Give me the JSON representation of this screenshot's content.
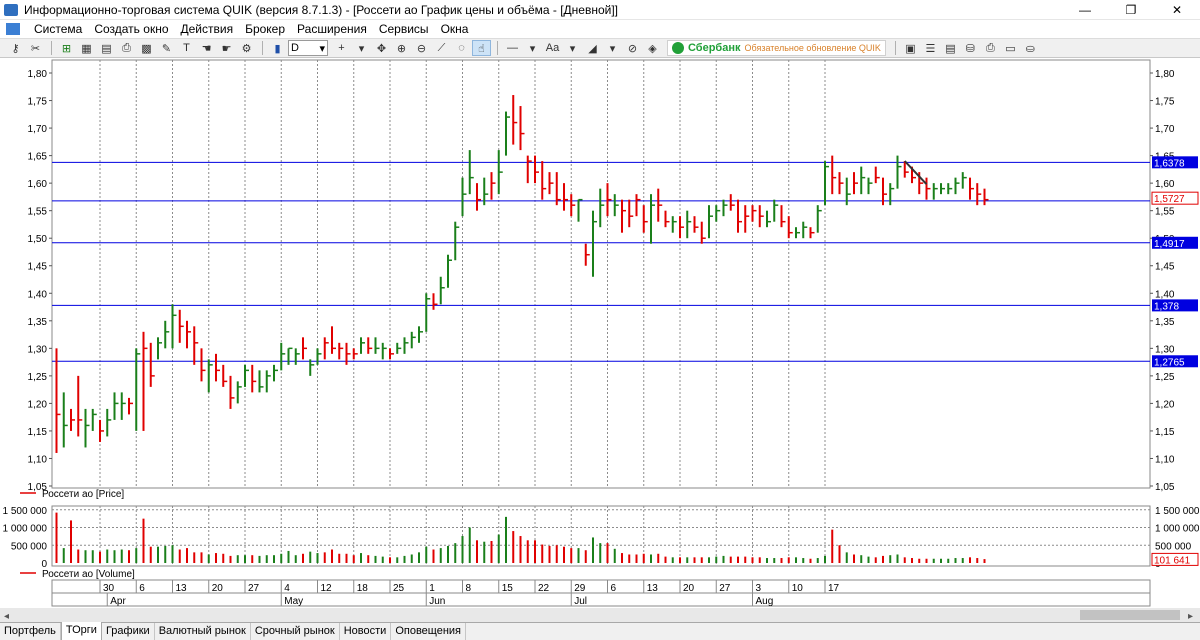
{
  "window": {
    "title": "Информационно-торговая система QUIK (версия 8.7.1.3) - [Россети ао График цены и объёма - [Дневной]]",
    "minimize": "—",
    "restore": "❐",
    "close": "✕"
  },
  "menu": [
    "Система",
    "Создать окно",
    "Действия",
    "Брокер",
    "Расширения",
    "Сервисы",
    "Окна"
  ],
  "toolbar": {
    "interval": "D",
    "text_tool": "Aa",
    "broker_name": "Сбербанк",
    "broker_message": "Обязательное обновление QUIK"
  },
  "tabs": [
    "Портфель",
    "ТОрги",
    "Графики",
    "Валютный рынок",
    "Срочный рынок",
    "Новости",
    "Оповещения"
  ],
  "active_tab": 1,
  "chart_data": {
    "type": "ohlc",
    "price_panel": {
      "legend": "Россети ао [Price]",
      "ylim": [
        1.05,
        1.82
      ],
      "y_ticks": [
        "1,05",
        "1,10",
        "1,15",
        "1,20",
        "1,25",
        "1,30",
        "1,35",
        "1,40",
        "1,45",
        "1,50",
        "1,55",
        "1,60",
        "1,65",
        "1,70",
        "1,75",
        "1,80"
      ],
      "levels": [
        {
          "value": 1.6378,
          "label": "1,6378",
          "color": "#0000e0"
        },
        {
          "value": 1.5677,
          "label": "",
          "color": "#0000e0"
        },
        {
          "value": 1.4917,
          "label": "1,4917",
          "color": "#0000e0"
        },
        {
          "value": 1.378,
          "label": "1,378",
          "color": "#0000e0"
        },
        {
          "value": 1.2765,
          "label": "1,2765",
          "color": "#0000e0"
        }
      ],
      "last_price": {
        "value": 1.5727,
        "label": "1,5727",
        "color": "#e00000"
      },
      "trendline": {
        "from": {
          "bar": 117,
          "price": 1.64
        },
        "to": {
          "bar": 120,
          "price": 1.598
        }
      },
      "up_color": "#1a7f1a",
      "down_color": "#e00000",
      "bars": [
        [
          1.3,
          1.11,
          1.18,
          0
        ],
        [
          1.22,
          1.12,
          1.16,
          1
        ],
        [
          1.19,
          1.15,
          1.17,
          0
        ],
        [
          1.25,
          1.14,
          1.17,
          0
        ],
        [
          1.19,
          1.12,
          1.16,
          1
        ],
        [
          1.19,
          1.15,
          1.18,
          1
        ],
        [
          1.17,
          1.13,
          1.15,
          0
        ],
        [
          1.19,
          1.14,
          1.17,
          1
        ],
        [
          1.22,
          1.17,
          1.2,
          1
        ],
        [
          1.22,
          1.17,
          1.2,
          1
        ],
        [
          1.21,
          1.18,
          1.2,
          0
        ],
        [
          1.3,
          1.15,
          1.29,
          1
        ],
        [
          1.33,
          1.15,
          1.3,
          0
        ],
        [
          1.31,
          1.23,
          1.25,
          0
        ],
        [
          1.32,
          1.28,
          1.31,
          1
        ],
        [
          1.35,
          1.3,
          1.33,
          1
        ],
        [
          1.38,
          1.3,
          1.36,
          1
        ],
        [
          1.37,
          1.31,
          1.34,
          0
        ],
        [
          1.35,
          1.3,
          1.33,
          0
        ],
        [
          1.34,
          1.27,
          1.31,
          0
        ],
        [
          1.3,
          1.24,
          1.26,
          0
        ],
        [
          1.28,
          1.22,
          1.27,
          1
        ],
        [
          1.29,
          1.24,
          1.26,
          0
        ],
        [
          1.27,
          1.23,
          1.24,
          0
        ],
        [
          1.25,
          1.19,
          1.21,
          0
        ],
        [
          1.24,
          1.2,
          1.23,
          1
        ],
        [
          1.27,
          1.23,
          1.26,
          1
        ],
        [
          1.27,
          1.22,
          1.24,
          0
        ],
        [
          1.26,
          1.22,
          1.23,
          1
        ],
        [
          1.26,
          1.22,
          1.25,
          1
        ],
        [
          1.27,
          1.24,
          1.26,
          1
        ],
        [
          1.31,
          1.26,
          1.29,
          1
        ],
        [
          1.3,
          1.27,
          1.3,
          1
        ],
        [
          1.3,
          1.27,
          1.29,
          1
        ],
        [
          1.32,
          1.28,
          1.3,
          0
        ],
        [
          1.28,
          1.25,
          1.27,
          1
        ],
        [
          1.3,
          1.27,
          1.29,
          1
        ],
        [
          1.32,
          1.28,
          1.31,
          0
        ],
        [
          1.34,
          1.29,
          1.3,
          0
        ],
        [
          1.31,
          1.28,
          1.3,
          0
        ],
        [
          1.31,
          1.27,
          1.29,
          0
        ],
        [
          1.3,
          1.28,
          1.29,
          0
        ],
        [
          1.32,
          1.29,
          1.31,
          1
        ],
        [
          1.32,
          1.29,
          1.3,
          0
        ],
        [
          1.32,
          1.29,
          1.3,
          1
        ],
        [
          1.31,
          1.28,
          1.3,
          1
        ],
        [
          1.3,
          1.28,
          1.29,
          0
        ],
        [
          1.31,
          1.29,
          1.3,
          1
        ],
        [
          1.32,
          1.29,
          1.31,
          1
        ],
        [
          1.33,
          1.3,
          1.32,
          1
        ],
        [
          1.34,
          1.31,
          1.33,
          1
        ],
        [
          1.4,
          1.33,
          1.39,
          1
        ],
        [
          1.4,
          1.37,
          1.38,
          0
        ],
        [
          1.43,
          1.38,
          1.41,
          1
        ],
        [
          1.47,
          1.41,
          1.46,
          1
        ],
        [
          1.53,
          1.46,
          1.52,
          1
        ],
        [
          1.61,
          1.54,
          1.58,
          1
        ],
        [
          1.66,
          1.58,
          1.61,
          1
        ],
        [
          1.6,
          1.55,
          1.57,
          0
        ],
        [
          1.61,
          1.56,
          1.58,
          1
        ],
        [
          1.62,
          1.57,
          1.6,
          0
        ],
        [
          1.66,
          1.58,
          1.62,
          1
        ],
        [
          1.73,
          1.65,
          1.72,
          1
        ],
        [
          1.76,
          1.67,
          1.71,
          0
        ],
        [
          1.74,
          1.66,
          1.69,
          0
        ],
        [
          1.65,
          1.6,
          1.64,
          0
        ],
        [
          1.65,
          1.6,
          1.62,
          0
        ],
        [
          1.64,
          1.57,
          1.59,
          0
        ],
        [
          1.62,
          1.58,
          1.6,
          0
        ],
        [
          1.62,
          1.56,
          1.57,
          0
        ],
        [
          1.6,
          1.55,
          1.57,
          0
        ],
        [
          1.58,
          1.54,
          1.56,
          0
        ],
        [
          1.57,
          1.53,
          1.57,
          1
        ],
        [
          1.49,
          1.45,
          1.47,
          0
        ],
        [
          1.55,
          1.43,
          1.53,
          1
        ],
        [
          1.59,
          1.52,
          1.56,
          1
        ],
        [
          1.6,
          1.54,
          1.57,
          0
        ],
        [
          1.58,
          1.54,
          1.56,
          1
        ],
        [
          1.57,
          1.51,
          1.55,
          0
        ],
        [
          1.57,
          1.52,
          1.54,
          0
        ],
        [
          1.58,
          1.54,
          1.57,
          0
        ],
        [
          1.56,
          1.51,
          1.53,
          0
        ],
        [
          1.58,
          1.49,
          1.56,
          1
        ],
        [
          1.59,
          1.53,
          1.56,
          0
        ],
        [
          1.55,
          1.52,
          1.53,
          0
        ],
        [
          1.54,
          1.51,
          1.53,
          1
        ],
        [
          1.54,
          1.5,
          1.52,
          0
        ],
        [
          1.55,
          1.5,
          1.53,
          1
        ],
        [
          1.54,
          1.51,
          1.52,
          0
        ],
        [
          1.53,
          1.49,
          1.5,
          0
        ],
        [
          1.56,
          1.5,
          1.54,
          1
        ],
        [
          1.56,
          1.53,
          1.55,
          1
        ],
        [
          1.57,
          1.54,
          1.56,
          1
        ],
        [
          1.58,
          1.55,
          1.56,
          0
        ],
        [
          1.57,
          1.51,
          1.53,
          0
        ],
        [
          1.56,
          1.51,
          1.54,
          0
        ],
        [
          1.56,
          1.53,
          1.55,
          0
        ],
        [
          1.56,
          1.52,
          1.54,
          0
        ],
        [
          1.55,
          1.52,
          1.53,
          1
        ],
        [
          1.57,
          1.53,
          1.56,
          1
        ],
        [
          1.56,
          1.52,
          1.53,
          0
        ],
        [
          1.54,
          1.5,
          1.51,
          0
        ],
        [
          1.52,
          1.5,
          1.51,
          1
        ],
        [
          1.53,
          1.5,
          1.52,
          1
        ],
        [
          1.52,
          1.5,
          1.51,
          0
        ],
        [
          1.56,
          1.51,
          1.55,
          1
        ],
        [
          1.64,
          1.56,
          1.63,
          1
        ],
        [
          1.65,
          1.58,
          1.61,
          0
        ],
        [
          1.62,
          1.58,
          1.6,
          0
        ],
        [
          1.61,
          1.56,
          1.58,
          1
        ],
        [
          1.62,
          1.58,
          1.6,
          0
        ],
        [
          1.63,
          1.58,
          1.61,
          1
        ],
        [
          1.61,
          1.58,
          1.6,
          1
        ],
        [
          1.63,
          1.6,
          1.61,
          0
        ],
        [
          1.61,
          1.56,
          1.58,
          0
        ],
        [
          1.6,
          1.56,
          1.59,
          1
        ],
        [
          1.65,
          1.59,
          1.63,
          1
        ],
        [
          1.64,
          1.61,
          1.62,
          0
        ],
        [
          1.63,
          1.6,
          1.61,
          0
        ],
        [
          1.62,
          1.58,
          1.6,
          0
        ],
        [
          1.61,
          1.57,
          1.59,
          0
        ],
        [
          1.6,
          1.57,
          1.59,
          1
        ],
        [
          1.6,
          1.58,
          1.59,
          1
        ],
        [
          1.6,
          1.58,
          1.59,
          1
        ],
        [
          1.61,
          1.58,
          1.6,
          1
        ],
        [
          1.62,
          1.59,
          1.61,
          1
        ],
        [
          1.61,
          1.57,
          1.59,
          0
        ],
        [
          1.6,
          1.56,
          1.58,
          0
        ],
        [
          1.59,
          1.56,
          1.57,
          0
        ]
      ]
    },
    "volume_panel": {
      "legend": "Россети ао [Volume]",
      "ylim": [
        0,
        1550000
      ],
      "y_ticks": [
        {
          "v": 0,
          "label": "0"
        },
        {
          "v": 500000,
          "label": "500 000"
        },
        {
          "v": 1000000,
          "label": "1 000 000"
        },
        {
          "v": 1500000,
          "label": "1 500 000"
        }
      ],
      "last_volume": {
        "value": 101641,
        "label": "101 641",
        "color": "#e00000"
      },
      "values": [
        1420000,
        420000,
        1200000,
        380000,
        360000,
        360000,
        320000,
        380000,
        360000,
        380000,
        360000,
        420000,
        1250000,
        460000,
        460000,
        480000,
        500000,
        380000,
        420000,
        300000,
        300000,
        240000,
        280000,
        260000,
        200000,
        220000,
        220000,
        220000,
        200000,
        220000,
        220000,
        260000,
        340000,
        220000,
        260000,
        320000,
        280000,
        300000,
        380000,
        260000,
        260000,
        220000,
        280000,
        220000,
        200000,
        180000,
        160000,
        160000,
        200000,
        240000,
        300000,
        460000,
        380000,
        420000,
        480000,
        560000,
        760000,
        1000000,
        640000,
        600000,
        620000,
        800000,
        1300000,
        900000,
        760000,
        640000,
        640000,
        520000,
        480000,
        500000,
        460000,
        420000,
        420000,
        360000,
        720000,
        560000,
        560000,
        400000,
        280000,
        240000,
        240000,
        260000,
        240000,
        260000,
        180000,
        160000,
        160000,
        160000,
        160000,
        160000,
        160000,
        180000,
        200000,
        180000,
        180000,
        180000,
        160000,
        160000,
        140000,
        140000,
        140000,
        160000,
        160000,
        140000,
        120000,
        140000,
        200000,
        940000,
        500000,
        300000,
        240000,
        220000,
        180000,
        160000,
        200000,
        220000,
        240000,
        160000,
        140000,
        120000,
        120000,
        120000,
        120000,
        120000,
        140000,
        140000,
        160000,
        140000,
        110000
      ]
    },
    "x_axis": {
      "days": [
        {
          "bar": 6,
          "label": "30"
        },
        {
          "bar": 11,
          "label": "6"
        },
        {
          "bar": 16,
          "label": "13"
        },
        {
          "bar": 21,
          "label": "20"
        },
        {
          "bar": 26,
          "label": "27"
        },
        {
          "bar": 31,
          "label": "4"
        },
        {
          "bar": 36,
          "label": "12"
        },
        {
          "bar": 41,
          "label": "18"
        },
        {
          "bar": 46,
          "label": "25"
        },
        {
          "bar": 51,
          "label": "1"
        },
        {
          "bar": 56,
          "label": "8"
        },
        {
          "bar": 61,
          "label": "15"
        },
        {
          "bar": 66,
          "label": "22"
        },
        {
          "bar": 71,
          "label": "29"
        },
        {
          "bar": 76,
          "label": "6"
        },
        {
          "bar": 81,
          "label": "13"
        },
        {
          "bar": 86,
          "label": "20"
        },
        {
          "bar": 91,
          "label": "27"
        },
        {
          "bar": 96,
          "label": "3"
        },
        {
          "bar": 101,
          "label": "10"
        },
        {
          "bar": 106,
          "label": "17"
        }
      ],
      "months": [
        {
          "bar": 7,
          "label": "Apr"
        },
        {
          "bar": 31,
          "label": "May"
        },
        {
          "bar": 51,
          "label": "Jun"
        },
        {
          "bar": 71,
          "label": "Jul"
        },
        {
          "bar": 96,
          "label": "Aug"
        }
      ]
    }
  }
}
